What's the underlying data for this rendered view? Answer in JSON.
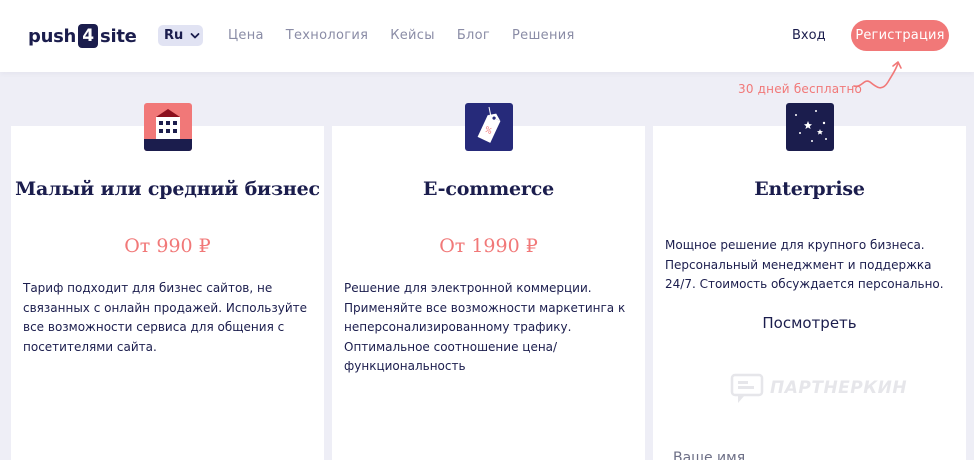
{
  "header": {
    "logo_left": "push",
    "logo_num": "4",
    "logo_right": "site",
    "lang": "Ru",
    "nav": [
      "Цена",
      "Технология",
      "Кейсы",
      "Блог",
      "Решения"
    ],
    "login": "Вход",
    "register": "Регистрация"
  },
  "trial_note": "30 дней бесплатно",
  "cards": [
    {
      "icon": "building-icon",
      "title": "Малый или средний бизнес",
      "price": "От 990 ₽",
      "description": "Тариф подходит для бизнес сайтов, не связанных с онлайн продажей. Используйте все возможности сервиса для общения с посетителями сайта."
    },
    {
      "icon": "price-tag-icon",
      "title": "E-commerce",
      "price": "От 1990 ₽",
      "description": "Решение для электронной коммерции. Применяйте все возможности маркетинга к неперсонализированному трафику. Оптимальное соотношение цена/функциональность"
    },
    {
      "icon": "stars-icon",
      "title": "Enterprise",
      "description": "Мощное решение для крупного бизнеса. Персональный менеджмент и поддержка 24/7. Стоимость обсуждается персонально.",
      "view_label": "Посмотреть",
      "name_placeholder": "Ваше имя"
    }
  ],
  "watermark": "ПАРТНЕРКИН",
  "colors": {
    "accent": "#f17878",
    "navy": "#1b1d4d",
    "background": "#eeeef6"
  }
}
